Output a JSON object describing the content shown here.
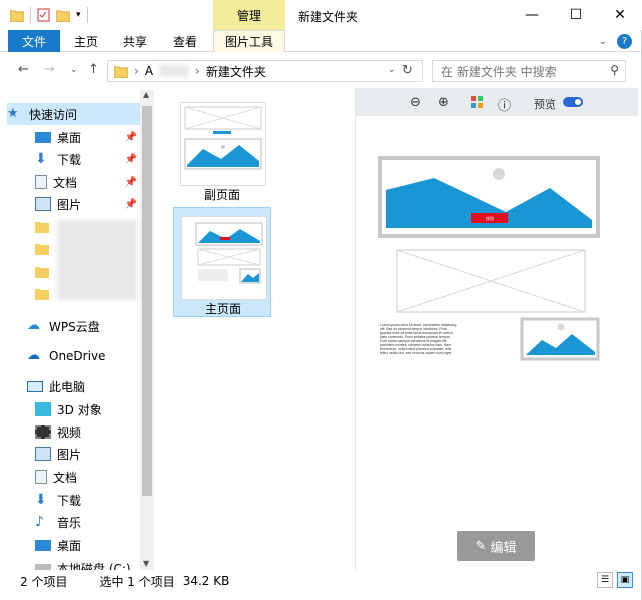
{
  "title": {
    "context_tab_header": "管理",
    "window_title": "新建文件夹",
    "minimize": "—",
    "maximize": "☐",
    "close": "✕"
  },
  "ribbon": {
    "tabs": [
      "文件",
      "主页",
      "共享",
      "查看",
      "图片工具"
    ]
  },
  "nav": {
    "address_prefix": "A",
    "address_current": "新建文件夹",
    "search_placeholder": "在 新建文件夹 中搜索"
  },
  "sidebar": {
    "items": [
      {
        "label": "快速访问",
        "icon": "star-icon",
        "pinned": false
      },
      {
        "label": "桌面",
        "icon": "desktop-icon",
        "pinned": true
      },
      {
        "label": "下载",
        "icon": "download-icon",
        "pinned": true
      },
      {
        "label": "文档",
        "icon": "document-icon",
        "pinned": true
      },
      {
        "label": "图片",
        "icon": "picture-icon",
        "pinned": true
      },
      {
        "label": "WPS云盘",
        "icon": "cloud-icon",
        "pinned": false
      },
      {
        "label": "OneDrive",
        "icon": "cloud-icon",
        "pinned": false
      },
      {
        "label": "此电脑",
        "icon": "computer-icon",
        "pinned": false
      },
      {
        "label": "3D 对象",
        "icon": "cube-icon",
        "pinned": false
      },
      {
        "label": "视频",
        "icon": "video-icon",
        "pinned": false
      },
      {
        "label": "图片",
        "icon": "picture-icon",
        "pinned": false
      },
      {
        "label": "文档",
        "icon": "document-icon",
        "pinned": false
      },
      {
        "label": "下载",
        "icon": "download-icon",
        "pinned": false
      },
      {
        "label": "音乐",
        "icon": "music-icon",
        "pinned": false
      },
      {
        "label": "桌面",
        "icon": "desktop-icon",
        "pinned": false
      },
      {
        "label": "本地磁盘 (C:)",
        "icon": "disk-icon",
        "pinned": false
      }
    ]
  },
  "files": [
    {
      "name": "副页面"
    },
    {
      "name": "主页面"
    }
  ],
  "preview": {
    "toggle_label": "预览",
    "edit_label": "编辑",
    "banner_button": "按钮",
    "text_lines": [
      "Lorem ipsum dolor sit amet, consectetur adipiscing",
      "elit. Sed do eiusmod tempor incididunt. Proin",
      "gravida dolor sit amet lacus accumsan et viverra",
      "justo commodo. Proin sodales pulvinar tempor.",
      "Cum sociis natoque penatibus et magnis dis",
      "parturient montes, nascetur ridiculus mus. Nam",
      "fermentum, nulla luctus pharetra vulputate, felis",
      "tellus mollis orci, sed rhoncus sapien nunc eget."
    ]
  },
  "status": {
    "count": "2 个项目",
    "selection": "选中 1 个项目",
    "size": "34.2 KB"
  },
  "colors": {
    "accent": "#1979ca",
    "context_tab": "#f3ec9a",
    "selection": "#cce8ff",
    "image_blue": "#1a96d4",
    "banner_red": "#e0101e"
  }
}
